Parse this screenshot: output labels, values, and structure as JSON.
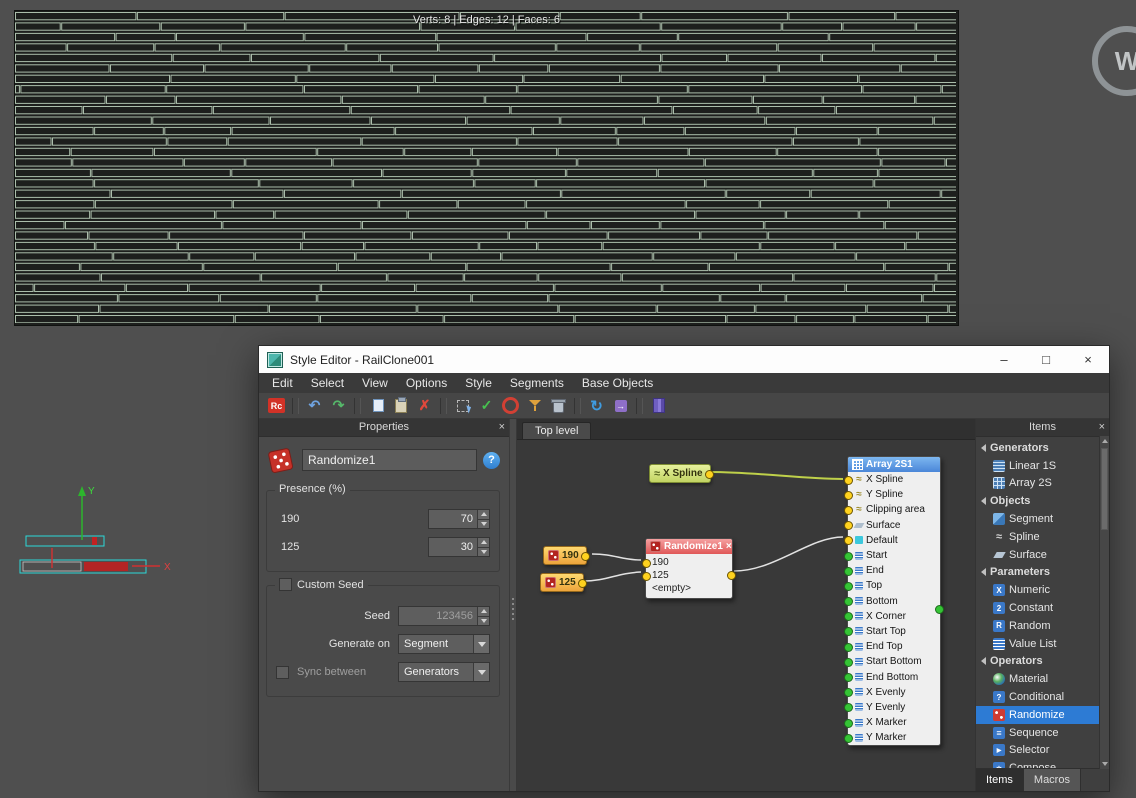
{
  "viewport": {
    "stats": "Verts: 8 | Edges: 12 | Faces: 6",
    "axis_x": "X",
    "axis_y": "Y",
    "watermark": "W"
  },
  "window": {
    "title": "Style Editor - RailClone001",
    "minimize": "–",
    "maximize": "□",
    "close": "×",
    "menus": [
      "Edit",
      "Select",
      "View",
      "Options",
      "Style",
      "Segments",
      "Base Objects"
    ],
    "toolbar": [
      {
        "name": "railclone-icon",
        "glyph": "Rc",
        "interactable": "true"
      },
      {
        "name": "separator",
        "interactable": "false"
      },
      {
        "name": "undo-icon",
        "glyph": "↶",
        "interactable": "true"
      },
      {
        "name": "redo-icon",
        "glyph": "↷",
        "interactable": "true"
      },
      {
        "name": "separator",
        "interactable": "false"
      },
      {
        "name": "copy-icon",
        "interactable": "true"
      },
      {
        "name": "paste-icon",
        "interactable": "true"
      },
      {
        "name": "delete-icon",
        "glyph": "✗",
        "interactable": "true"
      },
      {
        "name": "separator",
        "interactable": "false"
      },
      {
        "name": "pick-icon",
        "interactable": "true"
      },
      {
        "name": "check-icon",
        "glyph": "✓",
        "interactable": "true"
      },
      {
        "name": "record-icon",
        "interactable": "true"
      },
      {
        "name": "filter-icon",
        "interactable": "true"
      },
      {
        "name": "trash-icon",
        "interactable": "true"
      },
      {
        "name": "separator",
        "interactable": "false"
      },
      {
        "name": "refresh-icon",
        "glyph": "↻",
        "interactable": "true"
      },
      {
        "name": "export-icon",
        "interactable": "true"
      },
      {
        "name": "separator",
        "interactable": "false"
      },
      {
        "name": "library-icon",
        "interactable": "true"
      }
    ]
  },
  "properties": {
    "header": "Properties",
    "close_glyph": "×",
    "name_value": "Randomize1",
    "help": "?",
    "presence": {
      "title": "Presence (%)",
      "rows": [
        {
          "label": "190",
          "value": "70"
        },
        {
          "label": "125",
          "value": "30"
        }
      ]
    },
    "custom_seed": {
      "title": "Custom Seed",
      "seed_label": "Seed",
      "seed_value": "123456",
      "generate_on_label": "Generate on",
      "generate_on_value": "Segment",
      "sync_label": "Sync between",
      "sync_value": "Generators"
    }
  },
  "canvas": {
    "tab": "Top level",
    "xspline_label": "X Spline",
    "p190": "190",
    "p125": "125",
    "array_title": "Array 2S1",
    "array_inputs": [
      {
        "label": "X Spline",
        "dot": "yellow",
        "icon": "spline-icon"
      },
      {
        "label": "Y Spline",
        "dot": "yellow",
        "icon": "spline-icon"
      },
      {
        "label": "Clipping area",
        "dot": "yellow",
        "icon": "spline-icon"
      },
      {
        "label": "Surface",
        "dot": "yellow",
        "icon": "surface-icon"
      },
      {
        "label": "Default",
        "dot": "yellow",
        "icon": "default-icon"
      },
      {
        "label": "Start",
        "dot": "green",
        "icon": "segment-icon"
      },
      {
        "label": "End",
        "dot": "green",
        "icon": "segment-icon"
      },
      {
        "label": "Top",
        "dot": "green",
        "icon": "segment-icon"
      },
      {
        "label": "Bottom",
        "dot": "green",
        "icon": "segment-icon"
      },
      {
        "label": "X Corner",
        "dot": "green",
        "icon": "segment-icon"
      },
      {
        "label": "Start Top",
        "dot": "green",
        "icon": "segment-icon"
      },
      {
        "label": "End Top",
        "dot": "green",
        "icon": "segment-icon"
      },
      {
        "label": "Start Bottom",
        "dot": "green",
        "icon": "segment-icon"
      },
      {
        "label": "End Bottom",
        "dot": "green",
        "icon": "segment-icon"
      },
      {
        "label": "X Evenly",
        "dot": "green",
        "icon": "segment-icon"
      },
      {
        "label": "Y Evenly",
        "dot": "green",
        "icon": "segment-icon"
      },
      {
        "label": "X Marker",
        "dot": "green",
        "icon": "segment-icon"
      },
      {
        "label": "Y Marker",
        "dot": "green",
        "icon": "segment-icon"
      }
    ],
    "randomize_title": "Randomize1",
    "randomize_close": "×",
    "randomize_rows": [
      {
        "label": "190",
        "dot": "true"
      },
      {
        "label": "125",
        "dot": "true"
      },
      {
        "label": "<empty>",
        "dot": "false"
      }
    ]
  },
  "items": {
    "header": "Items",
    "close_glyph": "×",
    "tree": [
      {
        "type": "group",
        "label": "Generators"
      },
      {
        "type": "item",
        "label": "Linear 1S",
        "icon": "linear-icon"
      },
      {
        "type": "item",
        "label": "Array 2S",
        "icon": "array-icon"
      },
      {
        "type": "group",
        "label": "Objects"
      },
      {
        "type": "item",
        "label": "Segment",
        "icon": "segment-icon"
      },
      {
        "type": "item",
        "label": "Spline",
        "icon": "spline-icon"
      },
      {
        "type": "item",
        "label": "Surface",
        "icon": "surface-icon"
      },
      {
        "type": "group",
        "label": "Parameters"
      },
      {
        "type": "item",
        "label": "Numeric",
        "icon": "numeric-icon"
      },
      {
        "type": "item",
        "label": "Constant",
        "icon": "constant-icon"
      },
      {
        "type": "item",
        "label": "Random",
        "icon": "random-icon"
      },
      {
        "type": "item",
        "label": "Value List",
        "icon": "valuelist-icon"
      },
      {
        "type": "group",
        "label": "Operators"
      },
      {
        "type": "item",
        "label": "Material",
        "icon": "material-icon"
      },
      {
        "type": "item",
        "label": "Conditional",
        "icon": "conditional-icon"
      },
      {
        "type": "item",
        "label": "Randomize",
        "icon": "randomize-icon",
        "selected": "true"
      },
      {
        "type": "item",
        "label": "Sequence",
        "icon": "sequence-icon"
      },
      {
        "type": "item",
        "label": "Selector",
        "icon": "selector-icon"
      },
      {
        "type": "item",
        "label": "Compose",
        "icon": "compose-icon"
      }
    ],
    "tabs": [
      "Items",
      "Macros"
    ]
  }
}
